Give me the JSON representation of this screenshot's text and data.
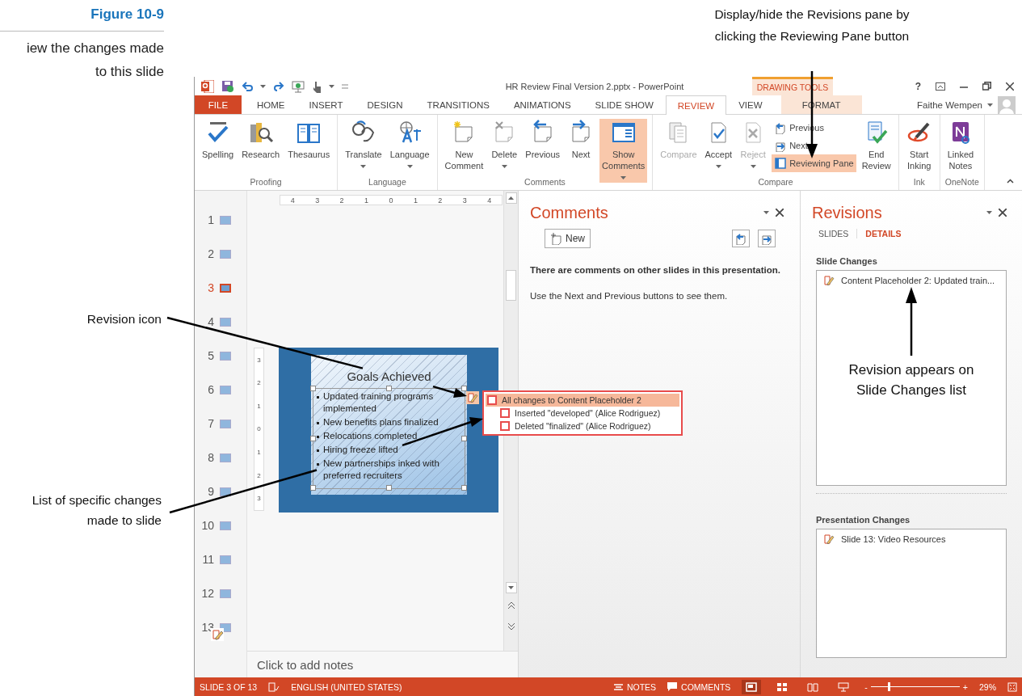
{
  "figure": {
    "number": "Figure 10-9",
    "caption": "iew the changes made to this slide"
  },
  "callouts": [
    {
      "text": "Display/hide the Revisions pane by clicking the Reviewing Pane button"
    },
    {
      "text": "Revision icon"
    },
    {
      "text": "List of specific changes made to slide"
    },
    {
      "text": "Revision appears on Slide Changes list"
    }
  ],
  "window": {
    "title": "HR Review Final Version 2.pptx - PowerPoint",
    "contextual_group": "DRAWING TOOLS",
    "help": "?"
  },
  "tabs": [
    {
      "label": "FILE",
      "kind": "file",
      "selected": false
    },
    {
      "label": "HOME",
      "kind": "normal",
      "selected": false
    },
    {
      "label": "INSERT",
      "kind": "normal",
      "selected": false
    },
    {
      "label": "DESIGN",
      "kind": "normal",
      "selected": false
    },
    {
      "label": "TRANSITIONS",
      "kind": "normal",
      "selected": false
    },
    {
      "label": "ANIMATIONS",
      "kind": "normal",
      "selected": false
    },
    {
      "label": "SLIDE SHOW",
      "kind": "normal",
      "selected": false
    },
    {
      "label": "REVIEW",
      "kind": "normal",
      "selected": true
    },
    {
      "label": "VIEW",
      "kind": "normal",
      "selected": false
    },
    {
      "label": "FORMAT",
      "kind": "contextual",
      "selected": false
    }
  ],
  "user": {
    "name": "Faithe Wempen"
  },
  "ribbon": {
    "groups": [
      {
        "label": "Proofing",
        "buttons": [
          {
            "kind": "large",
            "label": "Spelling",
            "dropdown": false,
            "disabled": false,
            "on": false
          },
          {
            "kind": "large",
            "label": "Research",
            "dropdown": false,
            "disabled": false,
            "on": false
          },
          {
            "kind": "large",
            "label": "Thesaurus",
            "dropdown": false,
            "disabled": false,
            "on": false
          }
        ]
      },
      {
        "label": "Language",
        "buttons": [
          {
            "kind": "large",
            "label": "Translate",
            "dropdown": true,
            "disabled": false,
            "on": false
          },
          {
            "kind": "large",
            "label": "Language",
            "dropdown": true,
            "disabled": false,
            "on": false
          }
        ]
      },
      {
        "label": "Comments",
        "buttons": [
          {
            "kind": "large",
            "label": "New Comment",
            "dropdown": false,
            "disabled": false,
            "on": false
          },
          {
            "kind": "large",
            "label": "Delete",
            "dropdown": true,
            "disabled": false,
            "on": false
          },
          {
            "kind": "large",
            "label": "Previous",
            "dropdown": false,
            "disabled": false,
            "on": false
          },
          {
            "kind": "large",
            "label": "Next",
            "dropdown": false,
            "disabled": false,
            "on": false
          },
          {
            "kind": "large",
            "label": "Show Comments",
            "dropdown": true,
            "disabled": false,
            "on": true
          }
        ]
      },
      {
        "label": "Compare",
        "buttons": [
          {
            "kind": "large",
            "label": "Compare",
            "dropdown": false,
            "disabled": true,
            "on": false
          },
          {
            "kind": "large",
            "label": "Accept",
            "dropdown": true,
            "disabled": false,
            "on": false
          },
          {
            "kind": "large",
            "label": "Reject",
            "dropdown": true,
            "disabled": true,
            "on": false
          },
          {
            "kind": "small",
            "label": "Previous",
            "dropdown": false,
            "disabled": false,
            "on": false
          },
          {
            "kind": "small",
            "label": "Next",
            "dropdown": false,
            "disabled": false,
            "on": false
          },
          {
            "kind": "small",
            "label": "Reviewing Pane",
            "dropdown": false,
            "disabled": false,
            "on": true
          },
          {
            "kind": "large",
            "label": "End Review",
            "dropdown": false,
            "disabled": false,
            "on": false
          }
        ]
      },
      {
        "label": "Ink",
        "buttons": [
          {
            "kind": "large",
            "label": "Start Inking",
            "dropdown": false,
            "disabled": false,
            "on": false
          }
        ]
      },
      {
        "label": "OneNote",
        "buttons": [
          {
            "kind": "large",
            "label": "Linked Notes",
            "dropdown": false,
            "disabled": false,
            "on": false
          }
        ]
      }
    ]
  },
  "slides_panel": {
    "slides": [
      {
        "number": "1",
        "selected": false,
        "revised": false
      },
      {
        "number": "2",
        "selected": false,
        "revised": false
      },
      {
        "number": "3",
        "selected": true,
        "revised": false
      },
      {
        "number": "4",
        "selected": false,
        "revised": false
      },
      {
        "number": "5",
        "selected": false,
        "revised": false
      },
      {
        "number": "6",
        "selected": false,
        "revised": false
      },
      {
        "number": "7",
        "selected": false,
        "revised": false
      },
      {
        "number": "8",
        "selected": false,
        "revised": false
      },
      {
        "number": "9",
        "selected": false,
        "revised": false
      },
      {
        "number": "10",
        "selected": false,
        "revised": false
      },
      {
        "number": "11",
        "selected": false,
        "revised": false
      },
      {
        "number": "12",
        "selected": false,
        "revised": false
      },
      {
        "number": "13",
        "selected": false,
        "revised": true
      }
    ]
  },
  "editor": {
    "ruler": [
      "4",
      "3",
      "2",
      "1",
      "0",
      "1",
      "2",
      "3",
      "4"
    ],
    "vertical_ruler": [
      "3",
      "2",
      "1",
      "0",
      "1",
      "2",
      "3"
    ],
    "slide": {
      "title": "Goals Achieved",
      "bullets": [
        "Updated training programs implemented",
        "New benefits plans finalized",
        "Relocations completed",
        "Hiring freeze lifted",
        "New partnerships inked with preferred recruiters"
      ]
    },
    "revision_popup": {
      "items": [
        {
          "text": "All changes to Content Placeholder 2",
          "checked": false,
          "selected": true,
          "children": [
            {
              "text": "Inserted \"developed\" (Alice Rodriguez)",
              "checked": false,
              "selected": false
            },
            {
              "text": "Deleted \"finalized\" (Alice Rodriguez)",
              "checked": false,
              "selected": false
            }
          ]
        }
      ]
    },
    "notes_placeholder": "Click to add notes"
  },
  "comments_pane": {
    "title": "Comments",
    "new_button": "New",
    "message": "There are comments on other slides in this presentation.",
    "hint": "Use the Next and Previous buttons to see them."
  },
  "revisions_pane": {
    "title": "Revisions",
    "tabs": [
      {
        "label": "SLIDES",
        "selected": false
      },
      {
        "label": "DETAILS",
        "selected": true
      }
    ],
    "sections": [
      {
        "heading": "Slide Changes",
        "items": [
          "Content Placeholder 2: Updated train..."
        ]
      },
      {
        "heading": "Presentation Changes",
        "items": [
          "Slide 13: Video Resources"
        ]
      }
    ]
  },
  "status_bar": {
    "slide": "SLIDE 3 OF 13",
    "language": "ENGLISH (UNITED STATES)",
    "notes": "NOTES",
    "comments": "COMMENTS",
    "views": [
      {
        "selected": true
      },
      {
        "selected": false
      },
      {
        "selected": false
      },
      {
        "selected": false
      }
    ],
    "zoom": {
      "minus": "-",
      "plus": "+",
      "level": 0.2,
      "percent": "29%"
    }
  }
}
